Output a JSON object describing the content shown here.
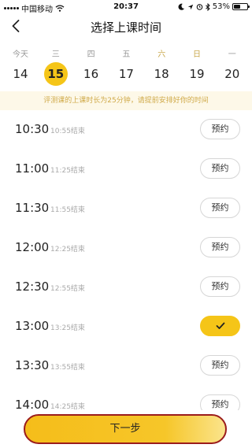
{
  "status_bar": {
    "carrier": "中国移动",
    "time": "20:37",
    "battery": "53%",
    "battery_level": 0.53,
    "icons": [
      "signal-icon",
      "wifi-icon",
      "moon-icon",
      "location-icon",
      "alarm-icon",
      "bluetooth-icon",
      "battery-icon"
    ]
  },
  "nav": {
    "title": "选择上课时间",
    "back_icon": "chevron-left-icon"
  },
  "calendar": {
    "selected_index": 1,
    "days": [
      {
        "weekday": "今天",
        "date": "14",
        "weekend": false
      },
      {
        "weekday": "三",
        "date": "15",
        "weekend": false
      },
      {
        "weekday": "四",
        "date": "16",
        "weekend": false
      },
      {
        "weekday": "五",
        "date": "17",
        "weekend": false
      },
      {
        "weekday": "六",
        "date": "18",
        "weekend": true
      },
      {
        "weekday": "日",
        "date": "19",
        "weekend": true
      },
      {
        "weekday": "一",
        "date": "20",
        "weekend": false
      }
    ]
  },
  "notice": "评测课的上课时长为25分钟，请提前安排好你的时间",
  "slots": [
    {
      "start": "10:30",
      "end": "10:55结束",
      "action": "预约",
      "booked": false
    },
    {
      "start": "11:00",
      "end": "11:25结束",
      "action": "预约",
      "booked": false
    },
    {
      "start": "11:30",
      "end": "11:55结束",
      "action": "预约",
      "booked": false
    },
    {
      "start": "12:00",
      "end": "12:25结束",
      "action": "预约",
      "booked": false
    },
    {
      "start": "12:30",
      "end": "12:55结束",
      "action": "预约",
      "booked": false
    },
    {
      "start": "13:00",
      "end": "13:25结束",
      "action": "",
      "booked": true
    },
    {
      "start": "13:30",
      "end": "13:55结束",
      "action": "预约",
      "booked": false
    },
    {
      "start": "14:00",
      "end": "14:25结束",
      "action": "预约",
      "booked": false
    }
  ],
  "next_button": "下一步",
  "colors": {
    "accent": "#f5c518",
    "notice_bg": "#fdf8e8",
    "notice_text": "#d0aa4a",
    "weekend": "#c9a84c",
    "highlight_border": "#9b1c1c"
  }
}
